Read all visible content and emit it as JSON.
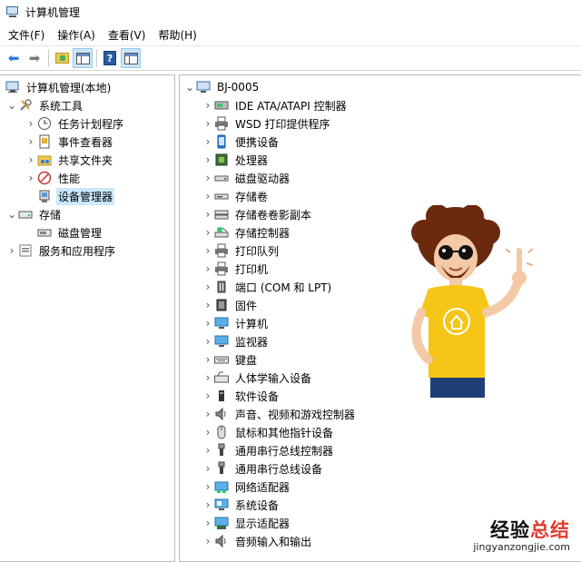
{
  "window": {
    "title": "计算机管理"
  },
  "menubar": {
    "items": [
      "文件(F)",
      "操作(A)",
      "查看(V)",
      "帮助(H)"
    ]
  },
  "toolbar": {
    "buttons": [
      "back-icon",
      "forward-icon",
      "folder-up-icon",
      "show-pane-icon",
      "help-icon",
      "properties-pane-icon"
    ]
  },
  "left_tree": {
    "root": "计算机管理(本地)",
    "system_tools": "系统工具",
    "task_scheduler": "任务计划程序",
    "event_viewer": "事件查看器",
    "shared_folders": "共享文件夹",
    "performance": "性能",
    "device_manager": "设备管理器",
    "storage": "存储",
    "disk_management": "磁盘管理",
    "services_apps": "服务和应用程序"
  },
  "device_tree": {
    "computer_name": "BJ-0005",
    "categories": [
      "IDE ATA/ATAPI 控制器",
      "WSD 打印提供程序",
      "便携设备",
      "处理器",
      "磁盘驱动器",
      "存储卷",
      "存储卷卷影副本",
      "存储控制器",
      "打印队列",
      "打印机",
      "端口 (COM 和 LPT)",
      "固件",
      "计算机",
      "监视器",
      "键盘",
      "人体学输入设备",
      "软件设备",
      "声音、视频和游戏控制器",
      "鼠标和其他指针设备",
      "通用串行总线控制器",
      "通用串行总线设备",
      "网络适配器",
      "系统设备",
      "显示适配器",
      "音频输入和输出"
    ]
  },
  "watermark": {
    "title_part1": "经验",
    "title_part2": "总结",
    "url": "jingyanzongjie.com"
  },
  "colors": {
    "selection": "#cce8ff",
    "accent_blue": "#2a7de1",
    "shirt_yellow": "#f5c518",
    "watermark_red": "#e23c2c"
  }
}
